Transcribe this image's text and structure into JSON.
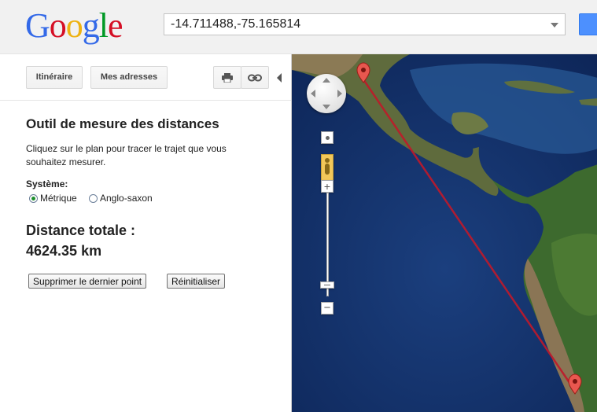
{
  "header": {
    "logo_letters": [
      {
        "char": "G",
        "color": "#3369e8"
      },
      {
        "char": "o",
        "color": "#d50f25"
      },
      {
        "char": "o",
        "color": "#eeb211"
      },
      {
        "char": "g",
        "color": "#3369e8"
      },
      {
        "char": "l",
        "color": "#009925"
      },
      {
        "char": "e",
        "color": "#d50f25"
      }
    ],
    "search_value": "-14.711488,-75.165814",
    "search_button_icon": "search-icon"
  },
  "toolbar": {
    "itinerary_label": "Itinéraire",
    "my_places_label": "Mes adresses",
    "print_icon": "print-icon",
    "link_icon": "link-icon",
    "collapse_icon": "collapse-left-icon"
  },
  "measure_tool": {
    "title": "Outil de mesure des distances",
    "description": "Cliquez sur le plan pour tracer le trajet que vous souhaitez mesurer.",
    "system_label": "Système:",
    "options": [
      {
        "label": "Métrique",
        "selected": true
      },
      {
        "label": "Anglo-saxon",
        "selected": false
      }
    ],
    "total_label": "Distance totale :",
    "total_value": "4624.35 km",
    "delete_last_label": "Supprimer le dernier point",
    "reset_label": "Réinitialiser"
  },
  "map": {
    "view": "satellite",
    "controls": [
      "pan-control",
      "street-view-pegman",
      "zoom-in",
      "zoom-slider",
      "zoom-out"
    ],
    "markers": 2,
    "path_color": "#c0192a"
  }
}
